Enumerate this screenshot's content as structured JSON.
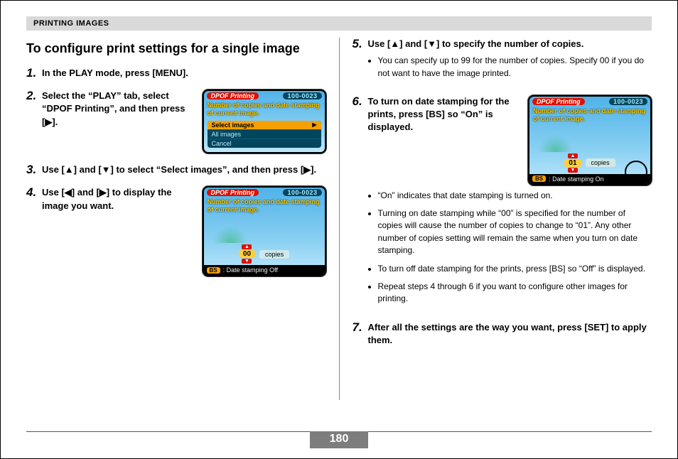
{
  "header": "PRINTING IMAGES",
  "heading": "To configure print settings for a single image",
  "steps": {
    "s1": "In the PLAY mode, press [MENU].",
    "s2": "Select the “PLAY” tab, select “DPOF Printing”, and then press [▶].",
    "s3": "Use [▲] and [▼] to select “Select images”, and then press [▶].",
    "s4": "Use [◀] and [▶] to display the image you want.",
    "s5": "Use [▲] and [▼] to specify the number of copies.",
    "s5_sub1": "You can specify up to 99 for the number of copies. Specify 00 if you do not want to have the image printed.",
    "s6": "To turn on date stamping for the prints, press [BS] so “On” is displayed.",
    "s6_sub1": "“On” indicates that date stamping is turned on.",
    "s6_sub2": "Turning on date stamping while “00” is specified for the number of copies will cause the number of copies to change to “01”. Any other number of copies setting will remain the same when you turn on date stamping.",
    "s6_sub3": "To turn off date stamping for the prints, press [BS] so “Off” is displayed.",
    "s6_sub4": "Repeat steps 4 through 6 if you want to configure other images for printing.",
    "s7": "After all the settings are the way you want, press [SET] to apply them."
  },
  "shots": {
    "title": "DPOF Printing",
    "filecount": "100-0023",
    "msg": "Number of copies and date stamping of current image.",
    "menu": {
      "opt1": "Select images",
      "opt2": "All images",
      "opt3": "Cancel"
    },
    "copies_label": "copies",
    "val_off": "00",
    "val_on": "01",
    "bs": "BS",
    "stamp_off": ": Date stamping Off",
    "stamp_on": ": Date stamping On"
  },
  "page_number": "180"
}
